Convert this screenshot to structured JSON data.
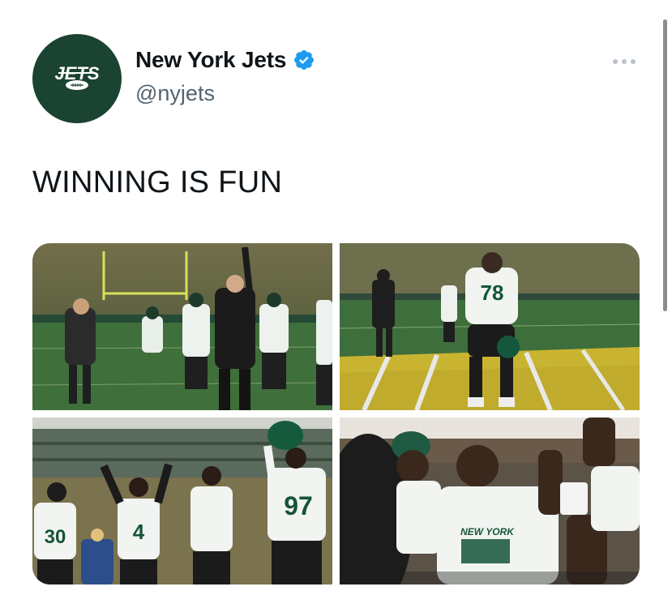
{
  "author": {
    "display_name": "New York Jets",
    "handle": "@nyjets",
    "avatar_text": "JETS",
    "verified": true
  },
  "tweet": {
    "text": "WINNING IS FUN"
  },
  "media": [
    {
      "icon": "photo-sideline-coaches"
    },
    {
      "icon": "photo-player-78-on-field",
      "jersey": "78"
    },
    {
      "icon": "photo-players-celebrating",
      "jerseys": [
        "30",
        "4",
        "97"
      ]
    },
    {
      "icon": "photo-locker-room-huddle"
    }
  ],
  "colors": {
    "brand_green": "#1a4331",
    "verified_blue": "#1d9bf0",
    "handle_gray": "#536471"
  },
  "icons": {
    "verified": "verified-badge-icon",
    "more": "more-options-icon"
  }
}
